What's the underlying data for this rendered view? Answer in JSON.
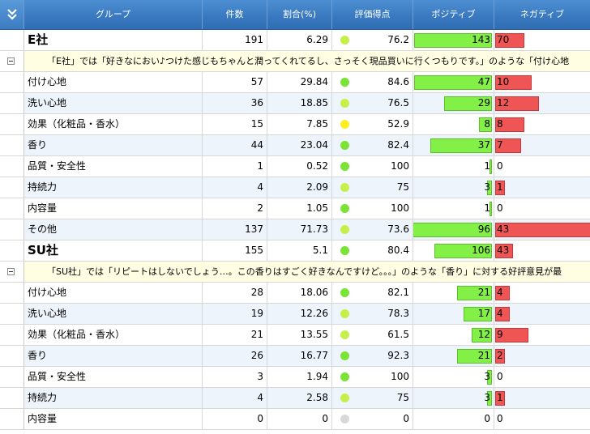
{
  "header": {
    "columns": [
      "グループ",
      "件数",
      "割合(%)",
      "評価得点",
      "ポジティブ",
      "ネガティブ"
    ]
  },
  "colors": {
    "dot_green": "#7be336",
    "dot_lightgreen": "#c6ef4a",
    "dot_yellow": "#ffee22",
    "dot_gray": "#d8d8d8",
    "positive_bar": "#82f046",
    "negative_bar": "#ef5555"
  },
  "groups": [
    {
      "name": "E社",
      "count": "191",
      "pct": "6.29",
      "score": "76.2",
      "dot": "dot_lightgreen",
      "pos": 143,
      "pos_label": "143",
      "neg": 70,
      "neg_label": "70",
      "comment": "「E社」では「好きなにおい♪つけた感じもちゃんと潤ってくれてるし、さっそく現品買いに行くつもりです。」のような「付け心地",
      "items": [
        {
          "name": "付け心地",
          "count": "57",
          "pct": "29.84",
          "score": "84.6",
          "dot": "dot_green",
          "pos": 47,
          "pos_label": "47",
          "neg": 10,
          "neg_label": "10"
        },
        {
          "name": "洗い心地",
          "count": "36",
          "pct": "18.85",
          "score": "76.5",
          "dot": "dot_lightgreen",
          "pos": 29,
          "pos_label": "29",
          "neg": 12,
          "neg_label": "12"
        },
        {
          "name": "効果（化粧品・香水）",
          "count": "15",
          "pct": "7.85",
          "score": "52.9",
          "dot": "dot_yellow",
          "pos": 8,
          "pos_label": "8",
          "neg": 8,
          "neg_label": "8"
        },
        {
          "name": "香り",
          "count": "44",
          "pct": "23.04",
          "score": "82.4",
          "dot": "dot_green",
          "pos": 37,
          "pos_label": "37",
          "neg": 7,
          "neg_label": "7"
        },
        {
          "name": "品質・安全性",
          "count": "1",
          "pct": "0.52",
          "score": "100",
          "dot": "dot_green",
          "pos": 1,
          "pos_label": "1",
          "neg": 0,
          "neg_label": "0"
        },
        {
          "name": "持続力",
          "count": "4",
          "pct": "2.09",
          "score": "75",
          "dot": "dot_lightgreen",
          "pos": 3,
          "pos_label": "3",
          "neg": 1,
          "neg_label": "1"
        },
        {
          "name": "内容量",
          "count": "2",
          "pct": "1.05",
          "score": "100",
          "dot": "dot_green",
          "pos": 1,
          "pos_label": "1",
          "neg": 0,
          "neg_label": "0"
        },
        {
          "name": "その他",
          "count": "137",
          "pct": "71.73",
          "score": "73.6",
          "dot": "dot_lightgreen",
          "pos": 96,
          "pos_label": "96",
          "neg": 43,
          "neg_label": "43"
        }
      ]
    },
    {
      "name": "SU社",
      "count": "155",
      "pct": "5.1",
      "score": "80.4",
      "dot": "dot_green",
      "pos": 106,
      "pos_label": "106",
      "neg": 43,
      "neg_label": "43",
      "comment": "「SU社」では「リピートはしないでしょう…。この香りはすごく好きなんですけど。。。」のような「香り」に対する好評意見が最",
      "items": [
        {
          "name": "付け心地",
          "count": "28",
          "pct": "18.06",
          "score": "82.1",
          "dot": "dot_green",
          "pos": 21,
          "pos_label": "21",
          "neg": 4,
          "neg_label": "4"
        },
        {
          "name": "洗い心地",
          "count": "19",
          "pct": "12.26",
          "score": "78.3",
          "dot": "dot_lightgreen",
          "pos": 17,
          "pos_label": "17",
          "neg": 4,
          "neg_label": "4"
        },
        {
          "name": "効果（化粧品・香水）",
          "count": "21",
          "pct": "13.55",
          "score": "61.5",
          "dot": "dot_lightgreen",
          "pos": 12,
          "pos_label": "12",
          "neg": 9,
          "neg_label": "9"
        },
        {
          "name": "香り",
          "count": "26",
          "pct": "16.77",
          "score": "92.3",
          "dot": "dot_green",
          "pos": 21,
          "pos_label": "21",
          "neg": 2,
          "neg_label": "2"
        },
        {
          "name": "品質・安全性",
          "count": "3",
          "pct": "1.94",
          "score": "100",
          "dot": "dot_green",
          "pos": 3,
          "pos_label": "3",
          "neg": 0,
          "neg_label": "0"
        },
        {
          "name": "持続力",
          "count": "4",
          "pct": "2.58",
          "score": "75",
          "dot": "dot_lightgreen",
          "pos": 3,
          "pos_label": "3",
          "neg": 1,
          "neg_label": "1"
        },
        {
          "name": "内容量",
          "count": "0",
          "pct": "0",
          "score": "0",
          "dot": "dot_gray",
          "pos": 0,
          "pos_label": "0",
          "neg": 0,
          "neg_label": "0"
        }
      ]
    }
  ]
}
